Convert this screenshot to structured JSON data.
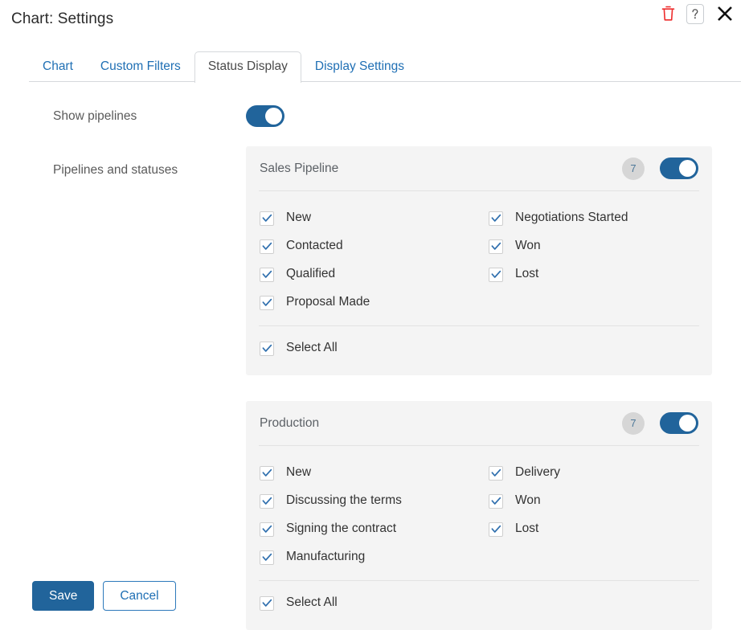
{
  "header": {
    "title": "Chart: Settings",
    "actions": [
      {
        "name": "delete-button",
        "icon": "trash-icon",
        "label": "Delete"
      },
      {
        "name": "help-button",
        "icon": "question-mark-icon",
        "label": "Help"
      },
      {
        "name": "close-button",
        "icon": "close-icon",
        "label": "Close"
      }
    ]
  },
  "tabs": [
    {
      "label": "Chart",
      "active": false
    },
    {
      "label": "Custom Filters",
      "active": false
    },
    {
      "label": "Status Display",
      "active": true
    },
    {
      "label": "Display Settings",
      "active": false
    }
  ],
  "form": {
    "show_pipelines": {
      "label": "Show pipelines",
      "toggle_on": true
    },
    "pipelines_and_statuses": {
      "label": "Pipelines and statuses"
    }
  },
  "pipelines": [
    {
      "title": "Sales Pipeline",
      "count": "7",
      "toggle_on": true,
      "left_statuses": [
        {
          "label": "New",
          "checked": true
        },
        {
          "label": "Contacted",
          "checked": true
        },
        {
          "label": "Qualified",
          "checked": true
        },
        {
          "label": "Proposal Made",
          "checked": true
        }
      ],
      "right_statuses": [
        {
          "label": "Negotiations Started",
          "checked": true
        },
        {
          "label": "Won",
          "checked": true
        },
        {
          "label": "Lost",
          "checked": true
        }
      ],
      "select_all": {
        "label": "Select All",
        "checked": true
      }
    },
    {
      "title": "Production",
      "count": "7",
      "toggle_on": true,
      "left_statuses": [
        {
          "label": "New",
          "checked": true
        },
        {
          "label": "Discussing the terms",
          "checked": true
        },
        {
          "label": "Signing the contract",
          "checked": true
        },
        {
          "label": "Manufacturing",
          "checked": true
        }
      ],
      "right_statuses": [
        {
          "label": "Delivery",
          "checked": true
        },
        {
          "label": "Won",
          "checked": true
        },
        {
          "label": "Lost",
          "checked": true
        }
      ],
      "select_all": {
        "label": "Select All",
        "checked": true
      }
    }
  ],
  "footer": {
    "save_label": "Save",
    "cancel_label": "Cancel"
  },
  "colors": {
    "accent_blue": "#21649B",
    "link_blue": "#1f6fb4",
    "delete_red": "#ee2b2b",
    "panel_bg": "#f4f4f4",
    "badge_bg": "#d6d6d6"
  }
}
